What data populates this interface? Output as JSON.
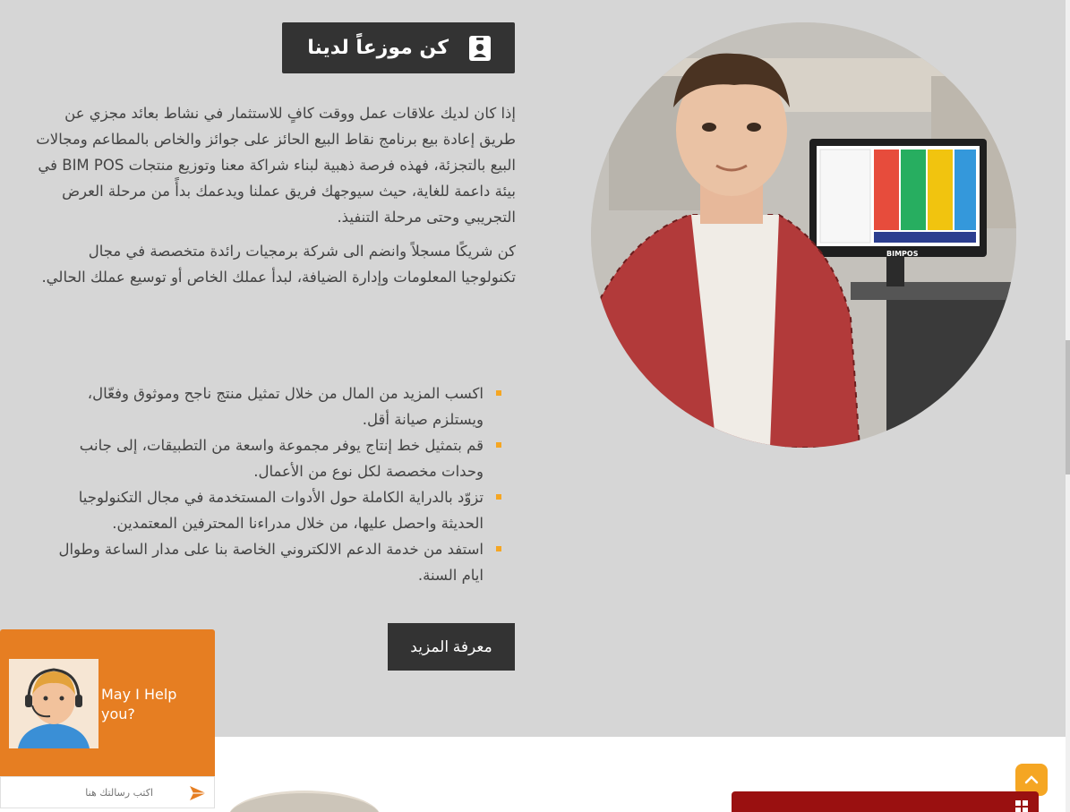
{
  "heading": {
    "title": "كن موزعاً لدينا",
    "icon": "id-badge-icon"
  },
  "paragraphs": [
    "إذا كان لديك علاقات عمل ووقت كافٍ للاستثمار في نشاط بعائد مجزي عن طريق إعادة بيع برنامج نقاط البيع الحائز على جوائز والخاص بالمطاعم ومجالات البيع بالتجزئة، فهذه فرصة ذهبية لبناء شراكة معنا وتوزيع منتجات BIM POS في بيئة داعمة للغاية، حيث سيوجهك فريق عملنا ويدعمك بدأً من مرحلة العرض التجريبي وحتى مرحلة التنفيذ.",
    "كن شريكًا مسجلاً وانضم الى شركة برمجيات رائدة متخصصة في مجال تكنولوجيا المعلومات وإدارة الضيافة، لبدأ عملك الخاص أو توسيع عملك الحالي."
  ],
  "benefits": [
    "اكسب المزيد من المال من خلال تمثيل منتج ناجح وموثوق وفعّال، ويستلزم صيانة أقل.",
    "قم بتمثيل خط إنتاج يوفر مجموعة واسعة من التطبيقات، إلى جانب وحدات مخصصة لكل نوع من الأعمال.",
    "تزوّد بالدراية الكاملة حول الأدوات المستخدمة في مجال التكنولوجيا الحديثة واحصل عليها، من خلال مدراءنا المحترفين المعتمدين.",
    "استفد من خدمة الدعم الالكتروني الخاصة بنا على مدار الساعة وطوال ايام السنة."
  ],
  "cta": {
    "label": "معرفة المزيد"
  },
  "pos_screen": {
    "brand": "BIMPOS"
  },
  "chat": {
    "help_text": "May I Help you?",
    "placeholder": "اكتب رسالتك هنا",
    "accent": "#e67e22"
  },
  "colors": {
    "section_bg": "#d6d6d6",
    "dark_box": "#333333",
    "bullet": "#f5a623",
    "scrolltop": "#f5a623",
    "next_section_red": "#9a1010"
  }
}
